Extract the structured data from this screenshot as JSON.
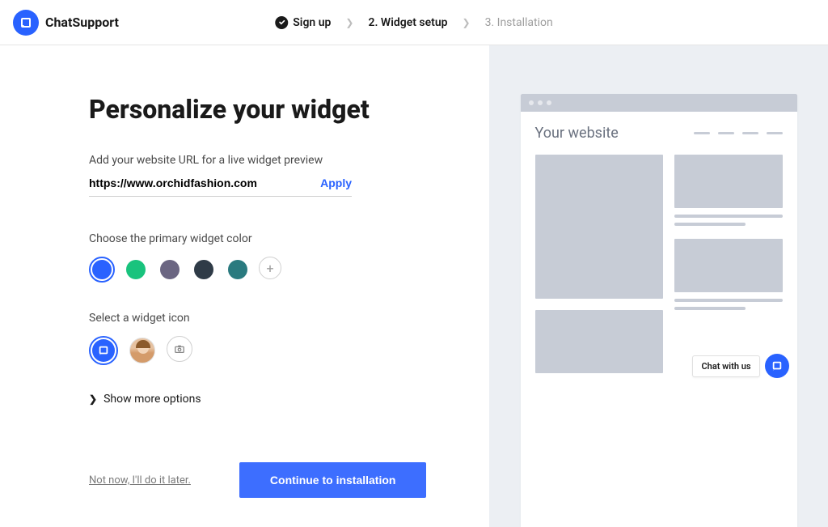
{
  "brand": {
    "name": "ChatSupport"
  },
  "steps": {
    "signup": "Sign up",
    "widget": "2.  Widget setup",
    "install": "3.  Installation"
  },
  "page": {
    "title": "Personalize your widget",
    "url_label": "Add your website URL for a live widget preview",
    "url_value": "https://www.orchidfashion.com",
    "apply": "Apply",
    "color_label": "Choose the primary widget color",
    "colors": [
      "#2962ff",
      "#19c37d",
      "#6b6682",
      "#2f3b47",
      "#2a7a7f"
    ],
    "icon_label": "Select a widget icon",
    "show_more": "Show more options",
    "skip": "Not now, I'll do it later.",
    "continue": "Continue to installation"
  },
  "preview": {
    "site_label": "Your website",
    "chat_label": "Chat with us"
  }
}
